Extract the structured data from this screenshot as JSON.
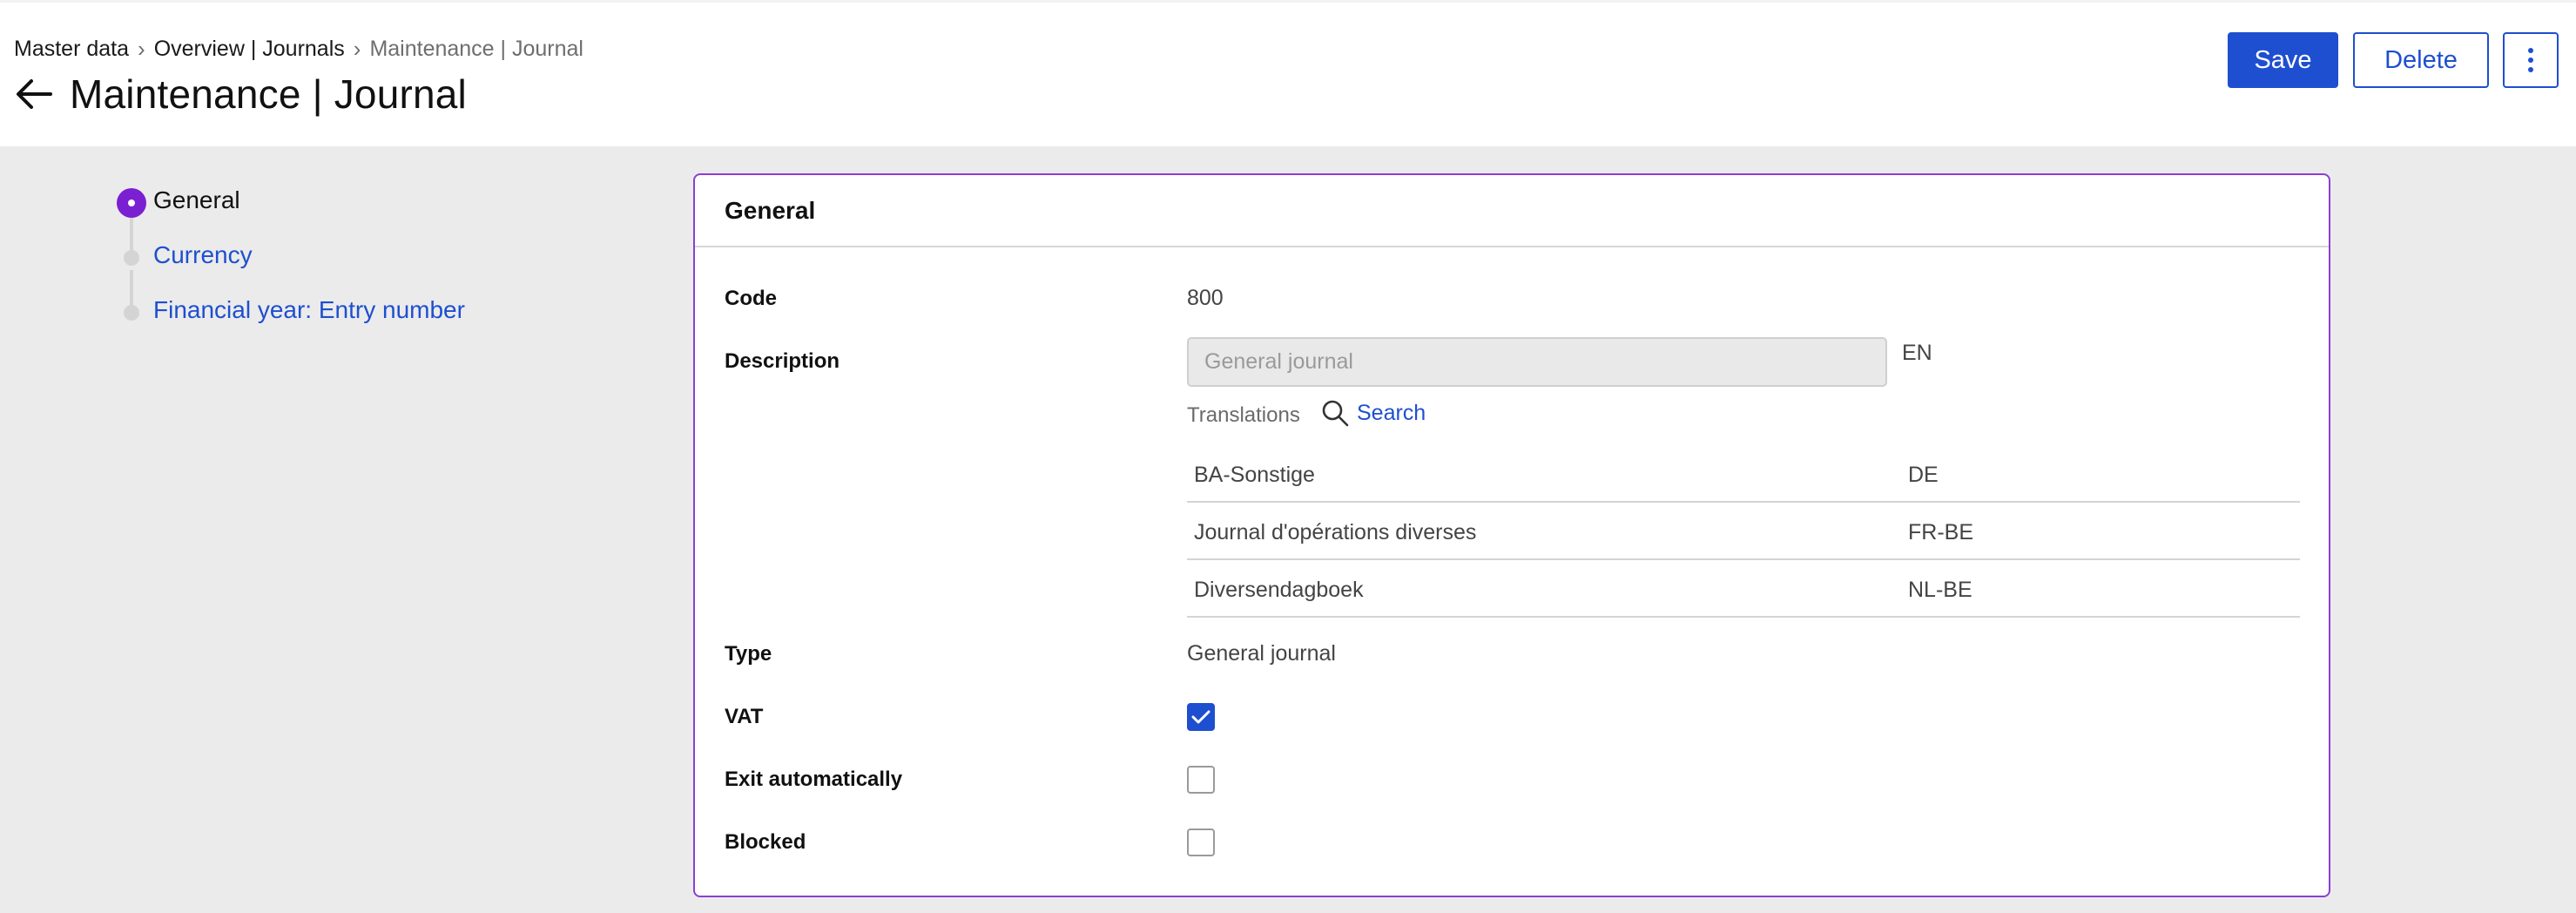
{
  "breadcrumb": {
    "items": [
      {
        "label": "Master data"
      },
      {
        "label": "Overview | Journals"
      },
      {
        "label": "Maintenance | Journal"
      }
    ],
    "separator": "›"
  },
  "page": {
    "title": "Maintenance | Journal"
  },
  "toolbar": {
    "save_label": "Save",
    "delete_label": "Delete",
    "more_icon": "vertical-ellipsis-icon"
  },
  "stepper": {
    "steps": [
      {
        "label": "General",
        "state": "active"
      },
      {
        "label": "Currency",
        "state": "link"
      },
      {
        "label": "Financial year: Entry number",
        "state": "link"
      }
    ]
  },
  "card": {
    "title": "General",
    "fields": {
      "code_label": "Code",
      "code_value": "800",
      "description_label": "Description",
      "description_placeholder": "General journal",
      "description_lang": "EN",
      "translations_label": "Translations",
      "search_label": "Search",
      "translations": [
        {
          "text": "BA-Sonstige",
          "lang": "DE"
        },
        {
          "text": "Journal d'opérations diverses",
          "lang": "FR-BE"
        },
        {
          "text": "Diversendagboek",
          "lang": "NL-BE"
        }
      ],
      "type_label": "Type",
      "type_value": "General journal",
      "vat_label": "VAT",
      "vat_checked": true,
      "exit_label": "Exit automatically",
      "exit_checked": false,
      "blocked_label": "Blocked",
      "blocked_checked": false
    }
  },
  "colors": {
    "accent": "#1e4fd0",
    "active_step": "#7a1fd1",
    "card_border": "#8a3fd6"
  }
}
